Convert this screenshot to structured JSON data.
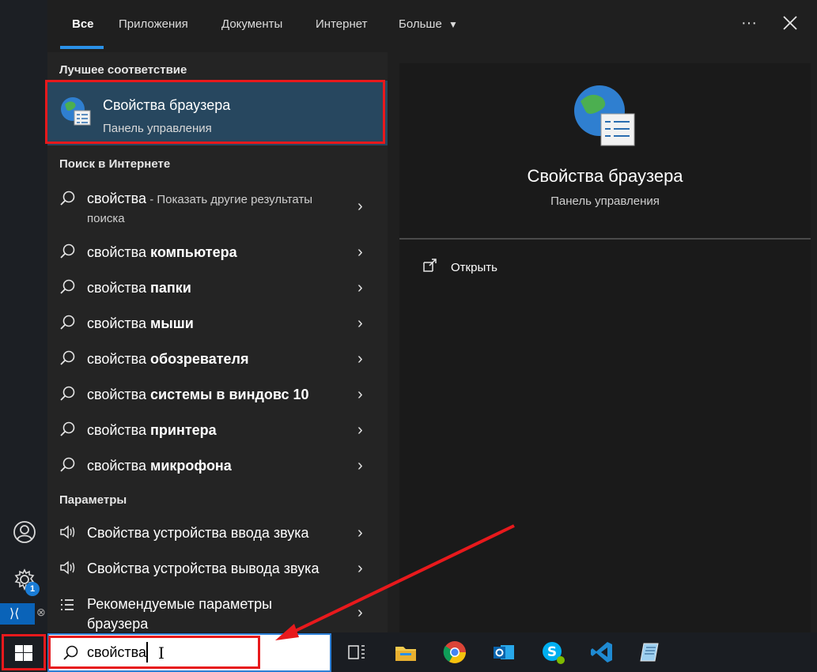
{
  "tabs": [
    {
      "label": "Все",
      "active": true
    },
    {
      "label": "Приложения"
    },
    {
      "label": "Документы"
    },
    {
      "label": "Интернет"
    },
    {
      "label": "Больше"
    }
  ],
  "more_options_label": "···",
  "sections": {
    "best_match": "Лучшее соответствие",
    "web_search": "Поиск в Интернете",
    "settings": "Параметры"
  },
  "best_match": {
    "title": "Свойства браузера",
    "subtitle": "Панель управления"
  },
  "web_results": [
    {
      "prefix": "свойства",
      "suffix": " - Показать другие результаты",
      "line2": "поиска"
    },
    {
      "prefix": "свойства ",
      "bold": "компьютера"
    },
    {
      "prefix": "свойства ",
      "bold": "папки"
    },
    {
      "prefix": "свойства ",
      "bold": "мыши"
    },
    {
      "prefix": "свойства ",
      "bold": "обозревателя"
    },
    {
      "prefix": "свойства ",
      "bold": "системы в виндовс 10"
    },
    {
      "prefix": "свойства ",
      "bold": "принтера"
    },
    {
      "prefix": "свойства ",
      "bold": "микрофона"
    }
  ],
  "settings_results": [
    {
      "label": "Свойства устройства ввода звука"
    },
    {
      "label": "Свойства устройства вывода звука"
    },
    {
      "label": "Рекомендуемые параметры",
      "line2": "браузера"
    }
  ],
  "preview": {
    "title": "Свойства браузера",
    "subtitle": "Панель управления",
    "open_label": "Открыть"
  },
  "search": {
    "value": "свойства"
  },
  "sidebar": {
    "settings_badge": "1"
  },
  "colors": {
    "accent": "#2a91e8",
    "highlight": "#e8191c",
    "selected_bg": "#27475f"
  }
}
